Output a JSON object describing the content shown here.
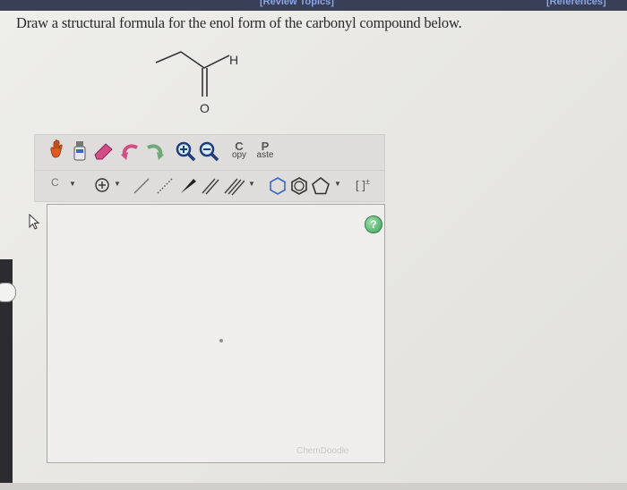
{
  "top_bar": {
    "link_center": "[Review Topics]",
    "link_right": "[References]"
  },
  "question": {
    "text": "Draw a structural formula for the enol form of the carbonyl compound below."
  },
  "molecule": {
    "h_label": "H",
    "o_label": "O"
  },
  "toolbar": {
    "copy_label_top": "C",
    "copy_label_bottom": "opy",
    "paste_label_top": "P",
    "paste_label_bottom": "aste",
    "element_selector": "C"
  },
  "canvas": {
    "help_label": "?",
    "watermark": "ChemDoodle"
  },
  "colors": {
    "help_green": "#3aa55a",
    "top_bar": "#3a3f58"
  }
}
